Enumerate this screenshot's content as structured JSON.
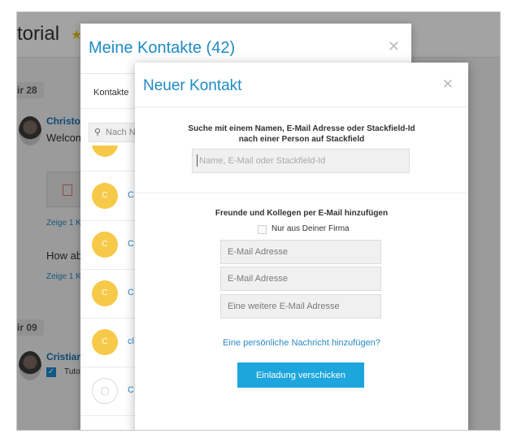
{
  "background": {
    "title": "torial",
    "dates": [
      "ir 28",
      "ir 09"
    ],
    "posts": [
      {
        "author": "Christo",
        "text": "Welcom",
        "link": "Zeige 1 K"
      },
      {
        "text": "How ab",
        "link": "Zeige 1 K"
      },
      {
        "author": "Cristian",
        "checkbox_label": "Tuto"
      }
    ]
  },
  "contacts_modal": {
    "title": "Meine Kontakte (42)",
    "tab": "Kontakte",
    "search_placeholder": "Nach N",
    "contacts": [
      {
        "initial": "C",
        "name": "C"
      },
      {
        "initial": "C",
        "name": "C"
      },
      {
        "initial": "C",
        "name": "C"
      },
      {
        "initial": "C",
        "name": "cl"
      },
      {
        "initial": "",
        "name": "C"
      }
    ]
  },
  "new_contact_modal": {
    "title": "Neuer Kontakt",
    "search_heading_line1": "Suche mit einem Namen, E-Mail Adresse oder Stackfield-Id",
    "search_heading_line2": "nach einer Person auf Stackfield",
    "search_placeholder": "Name, E-Mail oder Stackfield-Id",
    "invite_heading": "Freunde und Kollegen per E-Mail hinzufügen",
    "company_only_label": "Nur aus Deiner Firma",
    "email_placeholders": [
      "E-Mail Adresse",
      "E-Mail Adresse",
      "Eine weitere E-Mail Adresse"
    ],
    "personal_message_link": "Eine persönliche Nachricht hinzufügen?",
    "send_button": "Einladung verschicken"
  },
  "colors": {
    "accent": "#1e8bc3",
    "button": "#1da6de",
    "avatar": "#f7c948"
  }
}
